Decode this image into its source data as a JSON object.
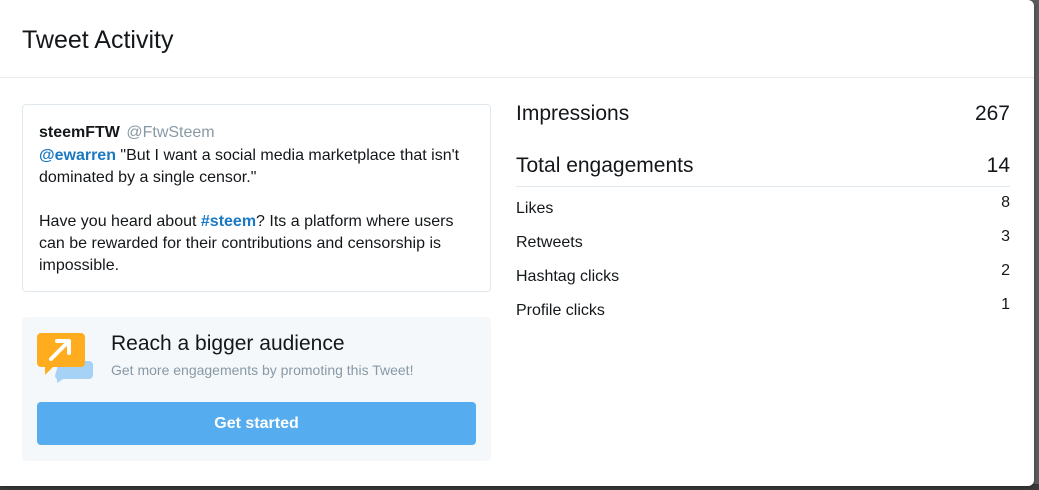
{
  "modal": {
    "title": "Tweet Activity"
  },
  "tweet": {
    "name": "steemFTW",
    "handle": "@FtwSteem",
    "mention": "@ewarren",
    "line1_rest": " \"But I want a social media marketplace that isn't dominated by a single censor.\"",
    "line2_pre": "Have you heard about ",
    "hashtag": "#steem",
    "line2_post": "? Its a platform where users can be rewarded for their contributions and censorship is impossible."
  },
  "promo": {
    "icon": "promote-arrow-icon",
    "title": "Reach a bigger audience",
    "subtitle": "Get more engagements by promoting this Tweet!",
    "button_label": "Get started"
  },
  "metrics": {
    "impressions": {
      "label": "Impressions",
      "value": "267"
    },
    "total_engagements": {
      "label": "Total engagements",
      "value": "14"
    },
    "breakdown": [
      {
        "label": "Likes",
        "value": "8"
      },
      {
        "label": "Retweets",
        "value": "3"
      },
      {
        "label": "Hashtag clicks",
        "value": "2"
      },
      {
        "label": "Profile clicks",
        "value": "1"
      }
    ]
  },
  "colors": {
    "accent": "#55acee",
    "link": "#1b78c2",
    "muted": "#8899a6",
    "icon_yellow": "#ffad1f",
    "icon_blue": "#a6d2f5"
  }
}
